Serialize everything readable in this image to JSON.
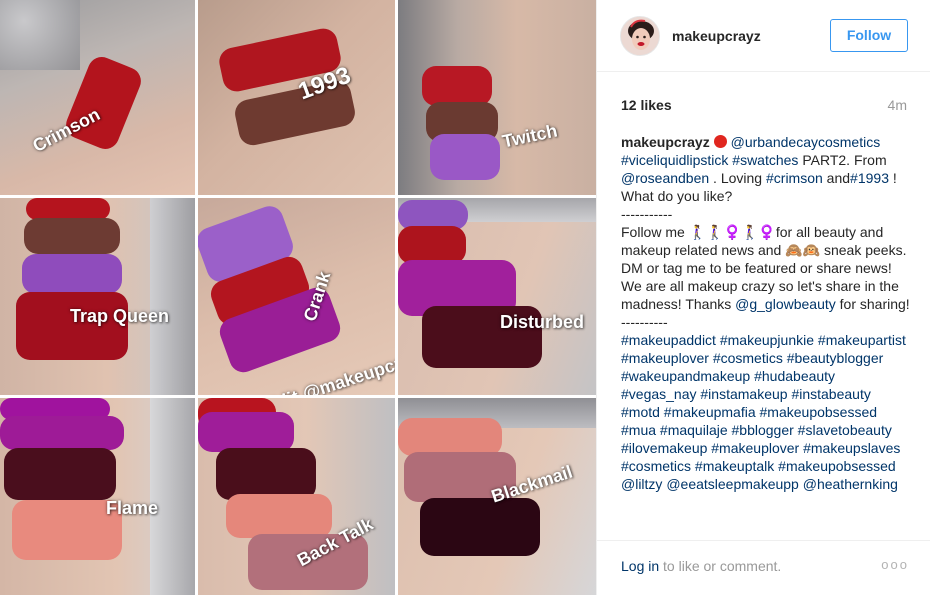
{
  "post": {
    "username": "makeupcrayz",
    "follow_label": "Follow",
    "likes": "12 likes",
    "time": "4m"
  },
  "photo_labels": {
    "t1": "Crimson",
    "t2": "1993",
    "t3": "Twitch",
    "t4": "Trap Queen",
    "t5": "Crank",
    "t5_edit": "Edit @makeupcrayz",
    "t6": "Disturbed",
    "t7": "Flame",
    "t8": "Back Talk",
    "t9": "Blackmail"
  },
  "caption": {
    "author": "makeupcrayz",
    "mention_urban": "@urbandecaycosmetics",
    "tag_viceliquid": "#viceliquidlipstick",
    "tag_swatches": "#swatches",
    "t_part2": " PART2. From ",
    "mention_rose": "@roseandben",
    "t_loving": " . Loving ",
    "tag_crimson": "#crimson",
    "t_and": " and",
    "tag_1993": "#1993",
    "t_whatdo": " ! What do you like?",
    "divider1": "-----------",
    "t_follow": "Follow me 🚶‍♀️🚶‍♀️♀️🚶‍♀️♀️for all beauty and makeup related news and 🙈🙉 sneak peeks. DM or tag me to be featured or share news! We are all makeup crazy so let's share in the madness! Thanks ",
    "mention_glow": "@g_glowbeauty",
    "t_sharing": " for sharing!",
    "divider2": "----------",
    "hashtags": "#makeupaddict #makeupjunkie #makeupartist #makeuplover #cosmetics #beautyblogger #wakeupandmakeup #hudabeauty #vegas_nay #instamakeup #instabeauty #motd #makeupmafia #makeupobsessed #mua #maquilaje #bblogger #slavetobeauty #ilovemakeup #makeuplover #makeupslaves #cosmetics #makeuptalk #makeupobsessed @liltzy @eeatsleepmakeupp @heathernking"
  },
  "footer": {
    "login": "Log in",
    "login_rest": " to like or comment.",
    "more": "ooo"
  },
  "colors": {
    "accent": "#3897f0",
    "link": "#003569",
    "muted": "#999999",
    "border": "#efefef"
  }
}
